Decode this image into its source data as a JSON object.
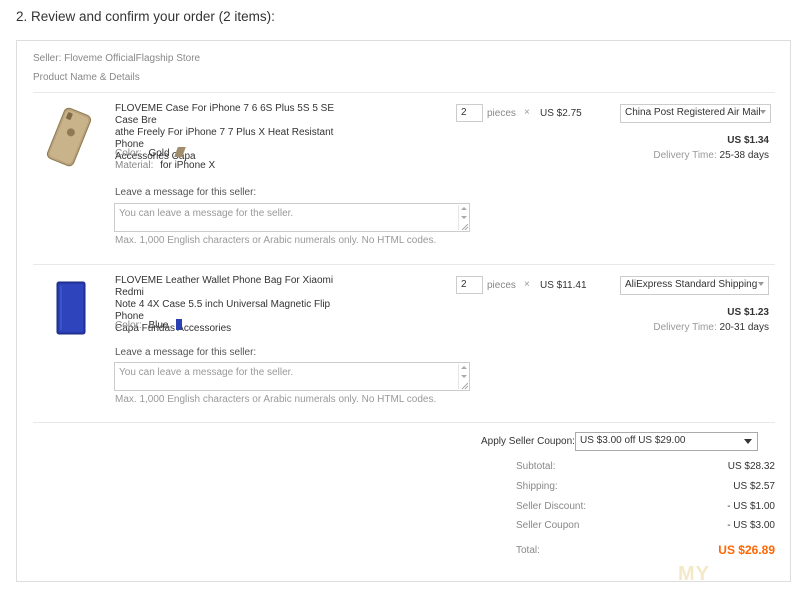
{
  "section_title": "2. Review and confirm your order (2 items):",
  "seller": "Seller: Floveme OfficialFlagship Store",
  "header_label": "Product Name & Details",
  "items": [
    {
      "name": "FLOVEME Case For iPhone 7 6 6S Plus 5S 5 SE Case Breathe Freely For iPhone 7 7 Plus X Heat Resistant Phone Accessories Capa",
      "name_lines": [
        "FLOVEME Case For iPhone 7 6 6S Plus 5S 5 SE Case Bre",
        "athe Freely For iPhone 7 7 Plus X Heat Resistant Phone",
        "Accessories Capa"
      ],
      "color_label": "Color:",
      "color_value": "Gold",
      "material_label": "Material:",
      "material_value": "for iPhone X",
      "quantity": "2",
      "pieces_label": "pieces",
      "times": "×",
      "unit_price": "US $2.75",
      "shipping_method": "China Post Registered Air Mail",
      "shipping_price": "US $1.34",
      "delivery_label": "Delivery Time:",
      "delivery_value": "25-38 days",
      "message_label": "Leave a message for this seller:",
      "message_placeholder": "You can leave a message for the seller.",
      "message_hint": "Max. 1,000 English characters or Arabic numerals only. No HTML codes.",
      "swatch_color": "#a08d6e",
      "product_color": "#b8a27a"
    },
    {
      "name": "FLOVEME Leather Wallet Phone Bag For Xiaomi Redmi Note 4 4X Case 5.5 inch Universal Magnetic Flip Phone Capa Fundas Accessories",
      "name_lines": [
        "FLOVEME Leather Wallet Phone Bag For Xiaomi Redmi",
        "Note 4 4X Case 5.5 inch Universal Magnetic Flip Phone",
        "Capa Fundas Accessories"
      ],
      "color_label": "Color:",
      "color_value": "Blue",
      "quantity": "2",
      "pieces_label": "pieces",
      "times": "×",
      "unit_price": "US $11.41",
      "shipping_method": "AliExpress Standard Shipping",
      "shipping_price": "US $1.23",
      "delivery_label": "Delivery Time:",
      "delivery_value": "20-31 days",
      "message_label": "Leave a message for this seller:",
      "message_placeholder": "You can leave a message for the seller.",
      "message_hint": "Max. 1,000 English characters or Arabic numerals only. No HTML codes.",
      "swatch_color": "#2a3fb0",
      "product_color": "#2438a8"
    }
  ],
  "coupon": {
    "label": "Apply Seller Coupon:",
    "value": "US $3.00 off US $29.00"
  },
  "summary": {
    "subtotal_label": "Subtotal:",
    "subtotal_value": "US $28.32",
    "shipping_label": "Shipping:",
    "shipping_value": "US $2.57",
    "seller_discount_label": "Seller Discount:",
    "seller_discount_value": "- US $1.00",
    "seller_coupon_label": "Seller Coupon",
    "seller_coupon_value": "- US $3.00",
    "total_label": "Total:",
    "total_value": "US $26.89"
  },
  "watermark": "MY"
}
